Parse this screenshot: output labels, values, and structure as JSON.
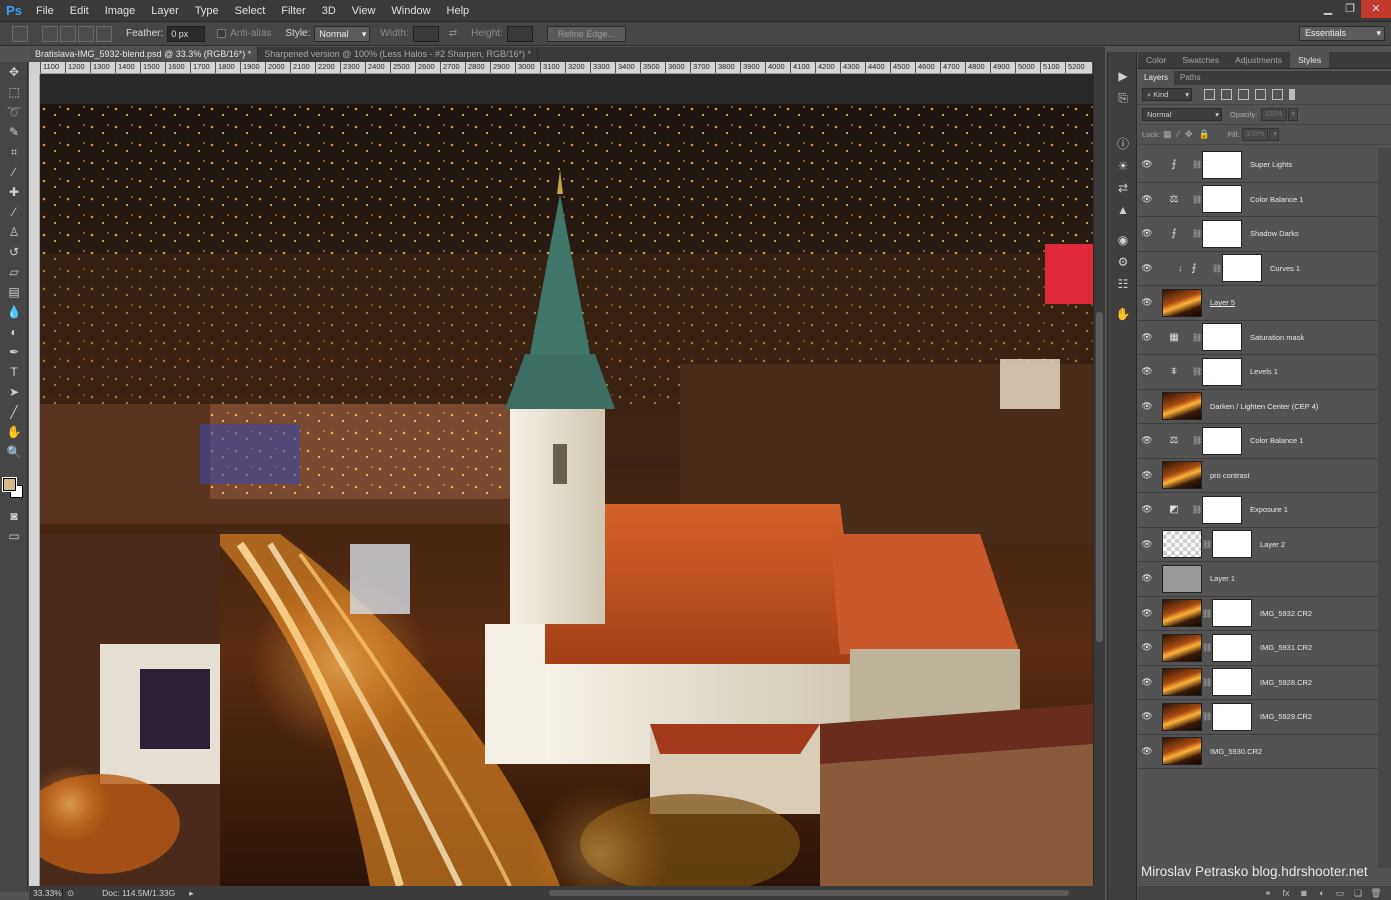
{
  "app": {
    "logo": "Ps"
  },
  "menu": [
    "File",
    "Edit",
    "Image",
    "Layer",
    "Type",
    "Select",
    "Filter",
    "3D",
    "View",
    "Window",
    "Help"
  ],
  "window_controls": {
    "minimize": "▁",
    "restore": "❐",
    "close": "✕"
  },
  "options": {
    "feather_label": "Feather:",
    "feather_value": "0 px",
    "antialias_label": "Anti-alias",
    "style_label": "Style:",
    "style_value": "Normal",
    "width_label": "Width:",
    "height_label": "Height:",
    "refine_label": "Refine Edge...",
    "workspace": "Essentials"
  },
  "tabs": [
    {
      "label": "Bratislava-IMG_5932-blend.psd @ 33.3% (RGB/16*) *",
      "active": true
    },
    {
      "label": "Sharpened version @ 100% (Less Halos - #2 Sharpen, RGB/16*) *",
      "active": false
    }
  ],
  "ruler": [
    "1100",
    "1200",
    "1300",
    "1400",
    "1500",
    "1600",
    "1700",
    "1800",
    "1900",
    "2000",
    "2100",
    "2200",
    "2300",
    "2400",
    "2500",
    "2600",
    "2700",
    "2800",
    "2900",
    "3000",
    "3100",
    "3200",
    "3300",
    "3400",
    "3500",
    "3600",
    "3700",
    "3800",
    "3900",
    "4000",
    "4100",
    "4200",
    "4300",
    "4400",
    "4500",
    "4600",
    "4700",
    "4800",
    "4900",
    "5000",
    "5100",
    "5200"
  ],
  "status": {
    "zoom": "33.33%",
    "doc": "Doc: 114.5M/1.33G"
  },
  "panels": {
    "top_tabs": [
      "Color",
      "Swatches",
      "Adjustments",
      "Styles"
    ],
    "sub_tabs": [
      "Layers",
      "Paths"
    ],
    "kind_label": "Kind",
    "blend_mode": "Normal",
    "opacity_label": "Opacity:",
    "opacity_value": "100%",
    "lock_label": "Lock:",
    "fill_label": "Fill:",
    "fill_value": "100%"
  },
  "layers": [
    {
      "name": "Super Lights",
      "type": "adjustment",
      "icon": "curves-icon",
      "mask": "dark"
    },
    {
      "name": "Color Balance 1",
      "type": "adjustment",
      "icon": "balance-icon",
      "mask": "white"
    },
    {
      "name": "Shadow Darks",
      "type": "adjustment",
      "icon": "curves-icon",
      "mask": "light"
    },
    {
      "name": "Curves 1",
      "type": "adjustment",
      "icon": "curves-icon",
      "mask": "white",
      "clipped": true
    },
    {
      "name": "Layer 5",
      "type": "pixel",
      "thumb": "photo",
      "underline": true
    },
    {
      "name": "Saturation mask",
      "type": "adjustment",
      "icon": "hue-icon",
      "mask": "mixed"
    },
    {
      "name": "Levels 1",
      "type": "adjustment",
      "icon": "levels-icon",
      "mask": "white"
    },
    {
      "name": "Darken / Lighten Center (CEP 4)",
      "type": "pixel",
      "thumb": "photo"
    },
    {
      "name": "Color Balance 1",
      "type": "adjustment",
      "icon": "balance-icon",
      "mask": "dark"
    },
    {
      "name": "pro contrast",
      "type": "pixel",
      "thumb": "photo"
    },
    {
      "name": "Exposure 1",
      "type": "adjustment",
      "icon": "exposure-icon",
      "mask": "light"
    },
    {
      "name": "Layer 2",
      "type": "pixel",
      "thumb": "checker",
      "mask": "white"
    },
    {
      "name": "Layer 1",
      "type": "pixel",
      "thumb": "gray"
    },
    {
      "name": "IMG_5932.CR2",
      "type": "pixel",
      "thumb": "photo",
      "mask": "dark"
    },
    {
      "name": "IMG_5931.CR2",
      "type": "pixel",
      "thumb": "photo",
      "mask": "mixed"
    },
    {
      "name": "IMG_5928.CR2",
      "type": "pixel",
      "thumb": "photo",
      "mask": "speck"
    },
    {
      "name": "IMG_5929.CR2",
      "type": "pixel",
      "thumb": "photo",
      "mask": "speck"
    },
    {
      "name": "IMG_5930.CR2",
      "type": "pixel",
      "thumb": "photo"
    }
  ],
  "watermark": "Miroslav  Petrasko  blog.hdrshooter.net",
  "colors": {
    "foreground": "#d5b984",
    "background": "#ffffff",
    "accent": "#3ba0f5"
  }
}
